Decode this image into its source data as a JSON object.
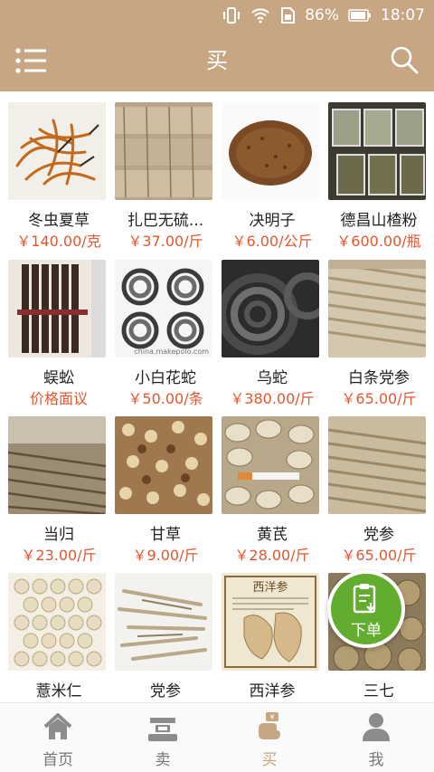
{
  "status": {
    "battery": "86%",
    "time": "18:07"
  },
  "header": {
    "title": "买"
  },
  "products": [
    {
      "name": "冬虫夏草",
      "price": "￥140.00/克"
    },
    {
      "name": "扎巴无硫...",
      "price": "￥37.00/斤"
    },
    {
      "name": "决明子",
      "price": "￥6.00/公斤"
    },
    {
      "name": "德昌山楂粉",
      "price": "￥600.00/瓶"
    },
    {
      "name": "蜈蚣",
      "price": "价格面议"
    },
    {
      "name": "小白花蛇",
      "price": "￥50.00/条"
    },
    {
      "name": "乌蛇",
      "price": "￥380.00/斤"
    },
    {
      "name": "白条党参",
      "price": "￥65.00/斤"
    },
    {
      "name": "当归",
      "price": "￥23.00/斤"
    },
    {
      "name": "甘草",
      "price": "￥9.00/斤"
    },
    {
      "name": "黄芪",
      "price": "￥28.00/斤"
    },
    {
      "name": "党参",
      "price": "￥65.00/斤"
    },
    {
      "name": "薏米仁",
      "price": ""
    },
    {
      "name": "党参",
      "price": ""
    },
    {
      "name": "西洋参",
      "price": ""
    },
    {
      "name": "三七",
      "price": ""
    }
  ],
  "image_watermarks": {
    "snake": "china.makepolo.com",
    "ginseng_box": "西洋参"
  },
  "fab": {
    "label": "下单"
  },
  "tabs": [
    {
      "label": "首页",
      "icon": "home-icon"
    },
    {
      "label": "卖",
      "icon": "scale-icon"
    },
    {
      "label": "买",
      "icon": "buy-hand-icon"
    },
    {
      "label": "我",
      "icon": "user-icon"
    }
  ],
  "colors": {
    "brand": "#c7a783",
    "price": "#e4572e",
    "fab": "#62ad2f"
  }
}
